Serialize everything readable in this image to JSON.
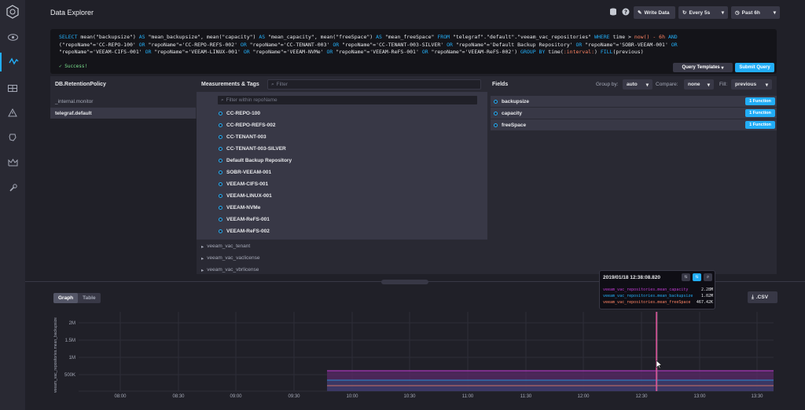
{
  "header": {
    "title": "Data Explorer",
    "write_data": "Write Data",
    "refresh": "Every 5s",
    "time_range": "Past 6h"
  },
  "sidebar": {
    "items": [
      "eye-icon",
      "graph-icon",
      "dashboard-icon",
      "alert-icon",
      "kapacitor-icon",
      "crown-icon",
      "wrench-icon"
    ]
  },
  "query": {
    "success": "✓ Success!",
    "templates_label": "Query Templates",
    "submit_label": "Submit Query"
  },
  "builder": {
    "db_header": "DB.RetentionPolicy",
    "databases": [
      "_internal.monitor",
      "telegraf.default"
    ],
    "meas_header": "Measurements & Tags",
    "filter_placeholder": "Filter",
    "tag_filter_placeholder": "Filter within repoName",
    "tag_values": [
      "CC-REPO-100",
      "CC-REPO-REFS-002",
      "CC-TENANT-003",
      "CC-TENANT-003-SILVER",
      "Default Backup Repository",
      "SOBR-VEEAM-001",
      "VEEAM-CIFS-001",
      "VEEAM-LINUX-001",
      "VEEAM-NVMe",
      "VEEAM-ReFS-001",
      "VEEAM-ReFS-002"
    ],
    "measurements": [
      "veeam_vac_tenant",
      "veeam_vac_vaclicense",
      "veeam_vac_vbrlicense"
    ],
    "fields_header": "Fields",
    "group_by_label": "Group by:",
    "group_by_value": "auto",
    "compare_label": "Compare:",
    "compare_value": "none",
    "fill_label": "Fill:",
    "fill_value": "previous",
    "fields": [
      {
        "name": "backupsize",
        "fn": "1 Function"
      },
      {
        "name": "capacity",
        "fn": "1 Function"
      },
      {
        "name": "freeSpace",
        "fn": "1 Function"
      }
    ]
  },
  "graph": {
    "tab_graph": "Graph",
    "tab_table": "Table",
    "csv_label": ".CSV",
    "ylabel": "veeam_vac_repositories.mean_backupsize",
    "yticks": [
      "2M",
      "1.5M",
      "1M",
      "500K"
    ],
    "xticks": [
      "08:00",
      "08:30",
      "09:00",
      "09:30",
      "10:00",
      "10:30",
      "11:00",
      "11:30",
      "12:00",
      "12:30",
      "13:00",
      "13:30"
    ]
  },
  "tooltip": {
    "time": "2019/01/18 12:38:08.820",
    "rows": [
      {
        "name": "veeam_vac_repositories.mean_capacity",
        "value": "2.28M",
        "color": "#bf3bd1"
      },
      {
        "name": "veeam_vac_repositories.mean_backupsize",
        "value": "1.02M",
        "color": "#22adf6"
      },
      {
        "name": "veeam_vac_repositories.mean_freeSpace",
        "value": "467.42K",
        "color": "#ff8564"
      }
    ]
  },
  "colors": {
    "accent": "#22adf6",
    "capacity": "#bf3bd1",
    "freespace": "#ff8564",
    "success": "#7ce490"
  }
}
